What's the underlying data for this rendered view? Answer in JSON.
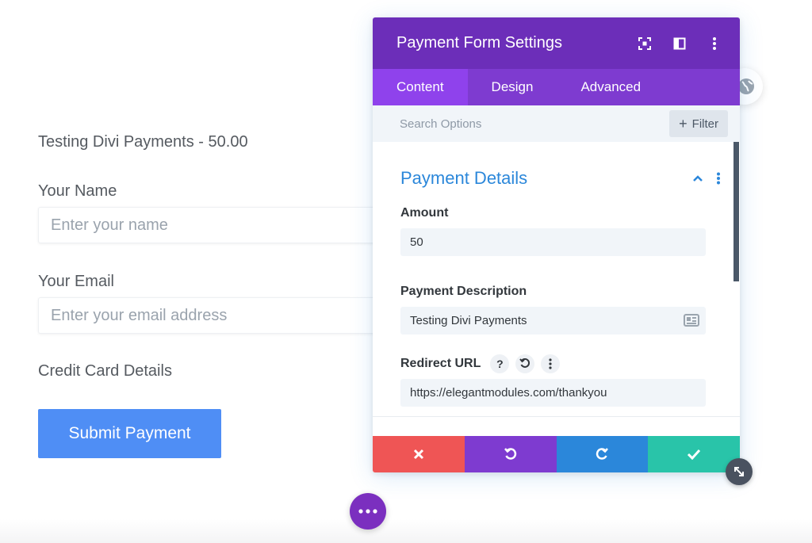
{
  "page": {
    "heading": "Testing Divi Payments - 50.00",
    "name_label": "Your Name",
    "name_placeholder": "Enter your name",
    "email_label": "Your Email",
    "email_placeholder": "Enter your email address",
    "card_label": "Credit Card Details",
    "submit_label": "Submit Payment"
  },
  "modal": {
    "title": "Payment Form Settings",
    "header_icons": [
      "expand-icon",
      "sidebar-layout-icon",
      "kebab-menu-icon"
    ],
    "tabs": [
      {
        "label": "Content",
        "active": true
      },
      {
        "label": "Design",
        "active": false
      },
      {
        "label": "Advanced",
        "active": false
      }
    ],
    "search_placeholder": "Search Options",
    "filter_label": "Filter",
    "section": {
      "title": "Payment Details",
      "amount_label": "Amount",
      "amount_value": "50",
      "description_label": "Payment Description",
      "description_value": "Testing Divi Payments",
      "redirect_label": "Redirect URL",
      "redirect_value": "https://elegantmodules.com/thankyou"
    },
    "footer_actions": [
      "cancel",
      "undo",
      "redo",
      "save"
    ]
  },
  "colors": {
    "header_purple": "#6c2eb9",
    "tab_purple": "#7e3bd0",
    "active_tab": "#8f42ec",
    "section_blue": "#2b87da",
    "cancel_red": "#ef5555",
    "save_green": "#29c4a9",
    "submit_blue": "#4f8ef5"
  }
}
